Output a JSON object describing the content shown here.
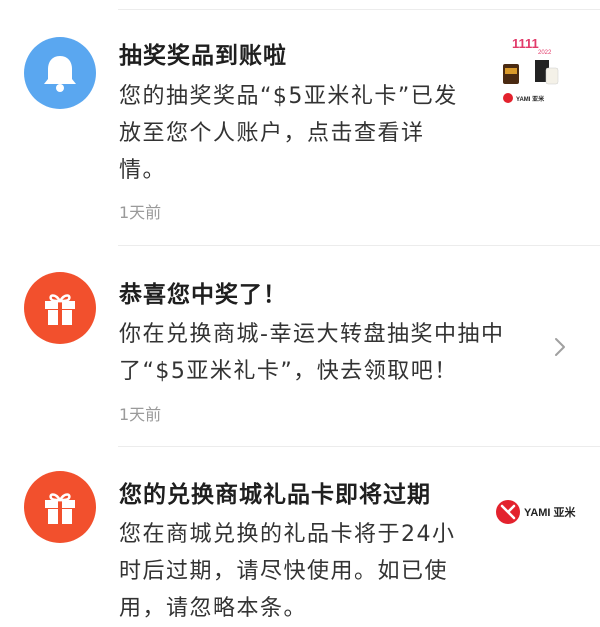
{
  "notifications": [
    {
      "icon": "bell-icon",
      "icon_color": "#5aa7f0",
      "title": "抽奖奖品到账啦",
      "body_lines": [
        "您的抽奖奖品“$5亚米礼卡”已发",
        "放至您个人账户，点击查看详",
        "情。"
      ],
      "time": "1天前",
      "thumbnail": {
        "badge_text": "1111",
        "badge_sub": "2022",
        "brand": "YAMI 亚米"
      }
    },
    {
      "icon": "gift-icon",
      "icon_color": "#f2502d",
      "title": "恭喜您中奖了！",
      "body_lines": [
        "你在兑换商城-幸运大转盘抽奖中抽中",
        "了“$5亚米礼卡”，快去领取吧！"
      ],
      "time": "1天前"
    },
    {
      "icon": "gift-icon",
      "icon_color": "#f2502d",
      "title": "您的兑换商城礼品卡即将过期",
      "body_lines": [
        "您在商城兑换的礼品卡将于24小",
        "时后过期，请尽快使用。如已使",
        "用，请忽略本条。"
      ],
      "thumbnail": {
        "brand": "YAMI 亚米"
      }
    }
  ],
  "colors": {
    "accent_red": "#f2502d",
    "accent_blue": "#5aa7f0",
    "muted": "#9a9a9a"
  }
}
